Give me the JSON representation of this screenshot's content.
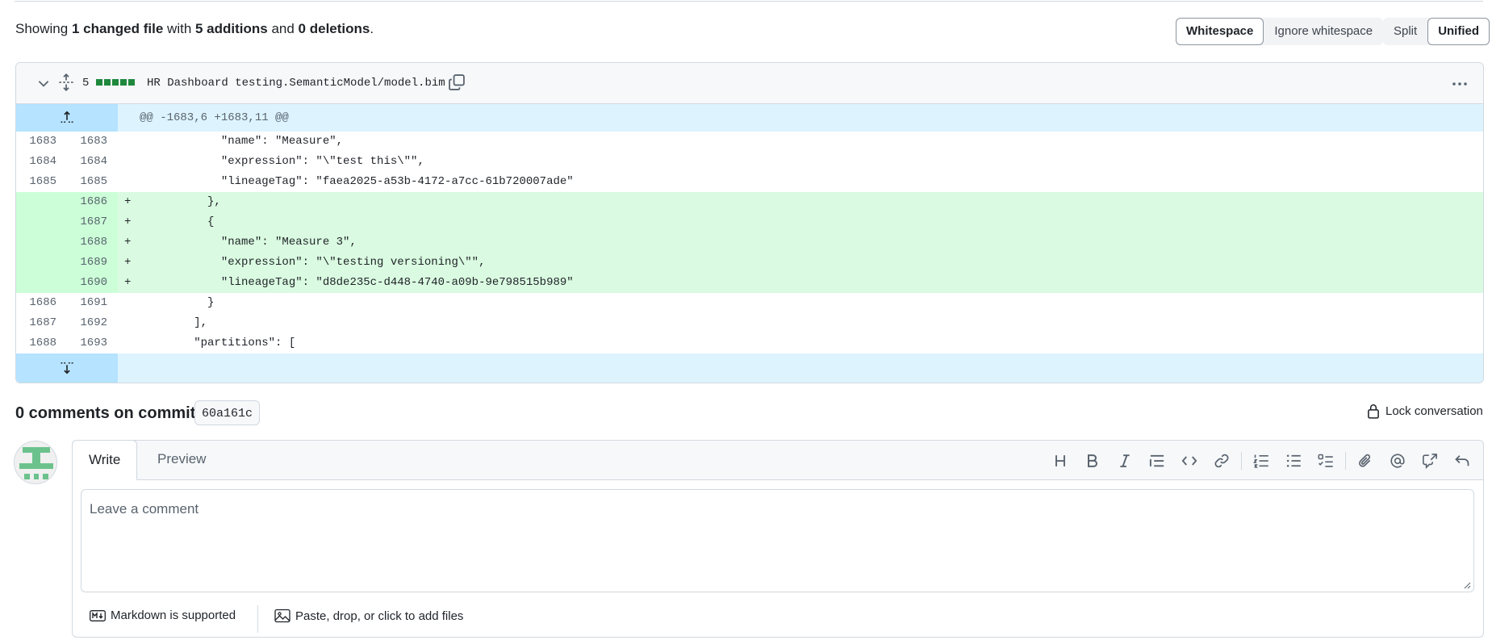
{
  "summary": {
    "prefix": "Showing ",
    "changed": "1 changed file",
    "with": " with ",
    "additions": "5 additions",
    "and": " and ",
    "deletions": "0 deletions",
    "suffix": "."
  },
  "whitespace_options": {
    "whitespace": "Whitespace",
    "ignore": "Ignore whitespace",
    "selected": "Whitespace"
  },
  "view_options": {
    "split": "Split",
    "unified": "Unified",
    "selected": "Unified"
  },
  "file": {
    "change_count": "5",
    "diffstat_color": "#1f883d",
    "name": "HR Dashboard testing.SemanticModel/model.bim",
    "hunk_header": "@@ -1683,6 +1683,11 @@",
    "lines": [
      {
        "type": "context",
        "old": "1683",
        "new": "1683",
        "sign": "",
        "code": "            \"name\": \"Measure\","
      },
      {
        "type": "context",
        "old": "1684",
        "new": "1684",
        "sign": "",
        "code": "            \"expression\": \"\\\"test this\\\"\","
      },
      {
        "type": "context",
        "old": "1685",
        "new": "1685",
        "sign": "",
        "code": "            \"lineageTag\": \"faea2025-a53b-4172-a7cc-61b720007ade\""
      },
      {
        "type": "add",
        "old": "",
        "new": "1686",
        "sign": "+",
        "code": "          },"
      },
      {
        "type": "add",
        "old": "",
        "new": "1687",
        "sign": "+",
        "code": "          {"
      },
      {
        "type": "add",
        "old": "",
        "new": "1688",
        "sign": "+",
        "code": "            \"name\": \"Measure 3\","
      },
      {
        "type": "add",
        "old": "",
        "new": "1689",
        "sign": "+",
        "code": "            \"expression\": \"\\\"testing versioning\\\"\","
      },
      {
        "type": "add",
        "old": "",
        "new": "1690",
        "sign": "+",
        "code": "            \"lineageTag\": \"d8de235c-d448-4740-a09b-9e798515b989\""
      },
      {
        "type": "context",
        "old": "1686",
        "new": "1691",
        "sign": "",
        "code": "          }"
      },
      {
        "type": "context",
        "old": "1687",
        "new": "1692",
        "sign": "",
        "code": "        ],"
      },
      {
        "type": "context",
        "old": "1688",
        "new": "1693",
        "sign": "",
        "code": "        \"partitions\": ["
      }
    ]
  },
  "comments": {
    "title": "0 comments on commit",
    "sha": "60a161c",
    "lock_label": "Lock conversation"
  },
  "composer": {
    "tab_write": "Write",
    "tab_preview": "Preview",
    "active_tab": "Write",
    "placeholder": "Leave a comment",
    "markdown_label": "Markdown is supported",
    "attach_label": "Paste, drop, or click to add files",
    "toolbar_icons": [
      "heading-icon",
      "bold-icon",
      "italic-icon",
      "quote-icon",
      "code-icon",
      "link-icon",
      "ordered-list-icon",
      "unordered-list-icon",
      "task-list-icon",
      "attach-icon",
      "mention-icon",
      "reference-icon",
      "undo-icon"
    ]
  }
}
